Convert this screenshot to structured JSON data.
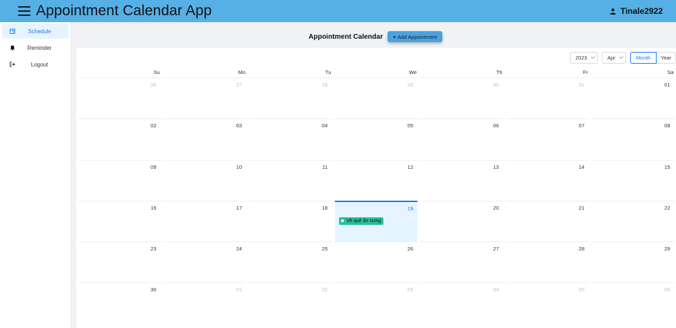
{
  "header": {
    "app_title": "Appointment Calendar App",
    "username": "Tinale2922",
    "accent_color": "#56b0e6"
  },
  "sidebar": {
    "items": [
      {
        "label": "Schedule",
        "icon": "calendar-icon",
        "active": true
      },
      {
        "label": "Reminder",
        "icon": "bell-icon",
        "active": false
      },
      {
        "label": "Logout",
        "icon": "logout-icon",
        "active": false
      }
    ]
  },
  "main": {
    "title": "Appointment Calendar",
    "add_button": "Add Appointment"
  },
  "calendar": {
    "year": "2023",
    "month": "Apr",
    "mode_month": "Month",
    "mode_year": "Year",
    "weekdays": [
      "Su",
      "Mo",
      "Tu",
      "We",
      "Th",
      "Fr",
      "Sa"
    ],
    "weeks": [
      [
        "26",
        "27",
        "28",
        "29",
        "30",
        "31",
        "01"
      ],
      [
        "02",
        "03",
        "04",
        "05",
        "06",
        "07",
        "08"
      ],
      [
        "09",
        "10",
        "11",
        "12",
        "13",
        "14",
        "15"
      ],
      [
        "16",
        "17",
        "18",
        "19",
        "20",
        "21",
        "22"
      ],
      [
        "23",
        "24",
        "25",
        "26",
        "27",
        "28",
        "29"
      ],
      [
        "30",
        "01",
        "02",
        "03",
        "04",
        "05",
        "06"
      ]
    ],
    "selected_date": "19",
    "event": {
      "date": "19",
      "title": "Về quê ăn cưng",
      "color": "#2bbf9a"
    }
  }
}
